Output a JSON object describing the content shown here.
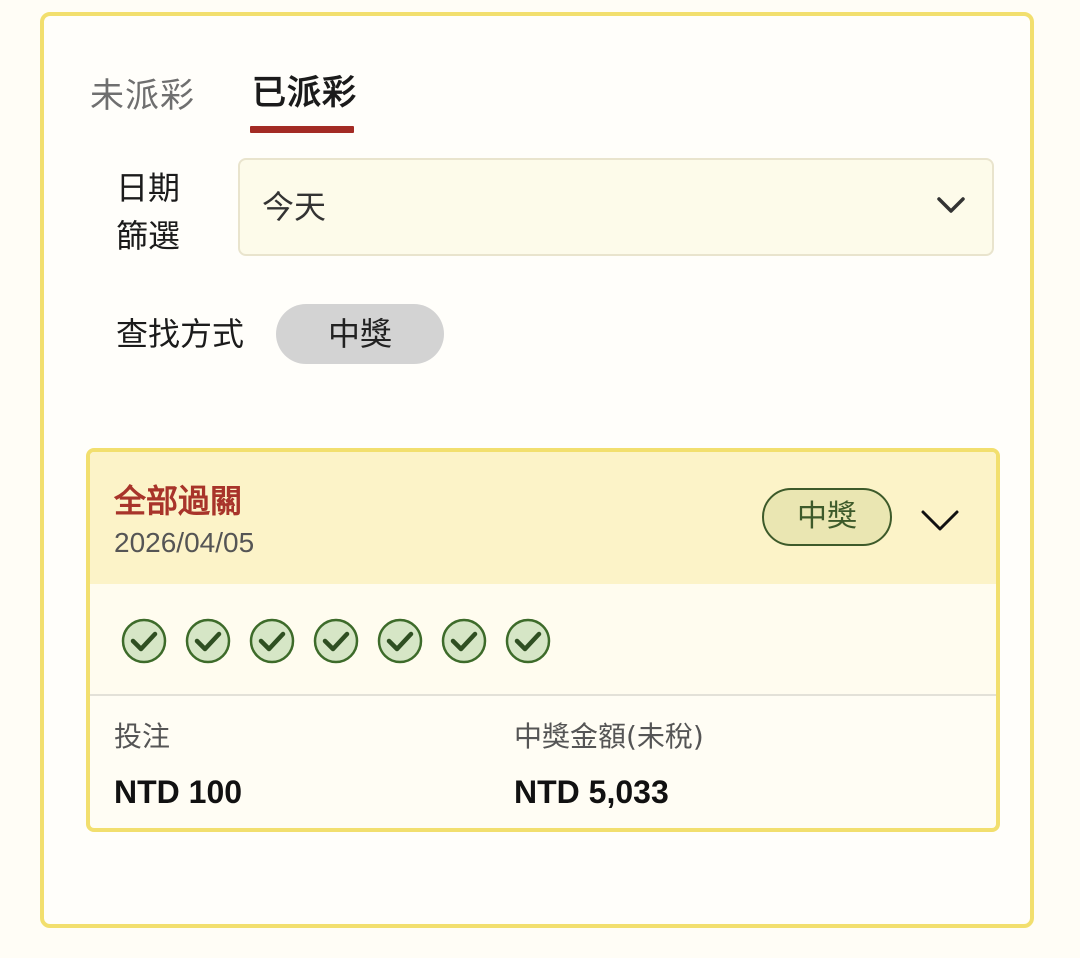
{
  "tabs": {
    "unsettled": "未派彩",
    "settled": "已派彩"
  },
  "date_filter": {
    "label_line1": "日期",
    "label_line2": "篩選",
    "selected_value": "今天"
  },
  "search_mode": {
    "label": "查找方式",
    "chip": "中獎"
  },
  "bet_card": {
    "title": "全部過關",
    "date": "2026/04/05",
    "status": "中獎",
    "legs_won": 7,
    "stake_label": "投注",
    "stake_value": "NTD 100",
    "winnings_label": "中獎金額(未稅)",
    "winnings_value": "NTD 5,033"
  },
  "colors": {
    "accent_red": "#a32b24",
    "border_yellow": "#f2df6e",
    "win_green": "#3d6b2a"
  },
  "icons": {
    "dropdown": "chevron-down-icon",
    "expand": "chevron-down-icon",
    "leg_result": "check-circle-icon"
  }
}
